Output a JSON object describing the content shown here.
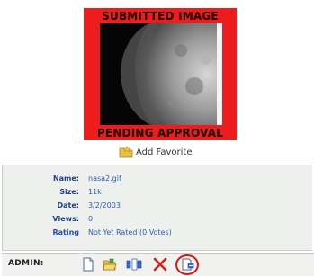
{
  "thumbnail": {
    "banner_top": "SUBMITTED IMAGE",
    "banner_bottom": "PENDING APPROVAL",
    "frame_color": "#ee1c1c"
  },
  "favorite": {
    "icon": "folder-star-icon",
    "label": "Add Favorite"
  },
  "details": [
    {
      "label": "Name:",
      "value": "nasa2.gif"
    },
    {
      "label": "Size:",
      "value": "11k"
    },
    {
      "label": "Date:",
      "value": "3/2/2003"
    },
    {
      "label": "Views:",
      "value": "0"
    },
    {
      "label": "Rating",
      "value": "Not Yet Rated (0 Votes)"
    }
  ],
  "admin": {
    "label": "ADMIN:",
    "tools": [
      "document-icon",
      "folder-open-icon",
      "move-icon",
      "delete-icon",
      "approve-icon"
    ],
    "highlight_color": "#dd1111"
  }
}
